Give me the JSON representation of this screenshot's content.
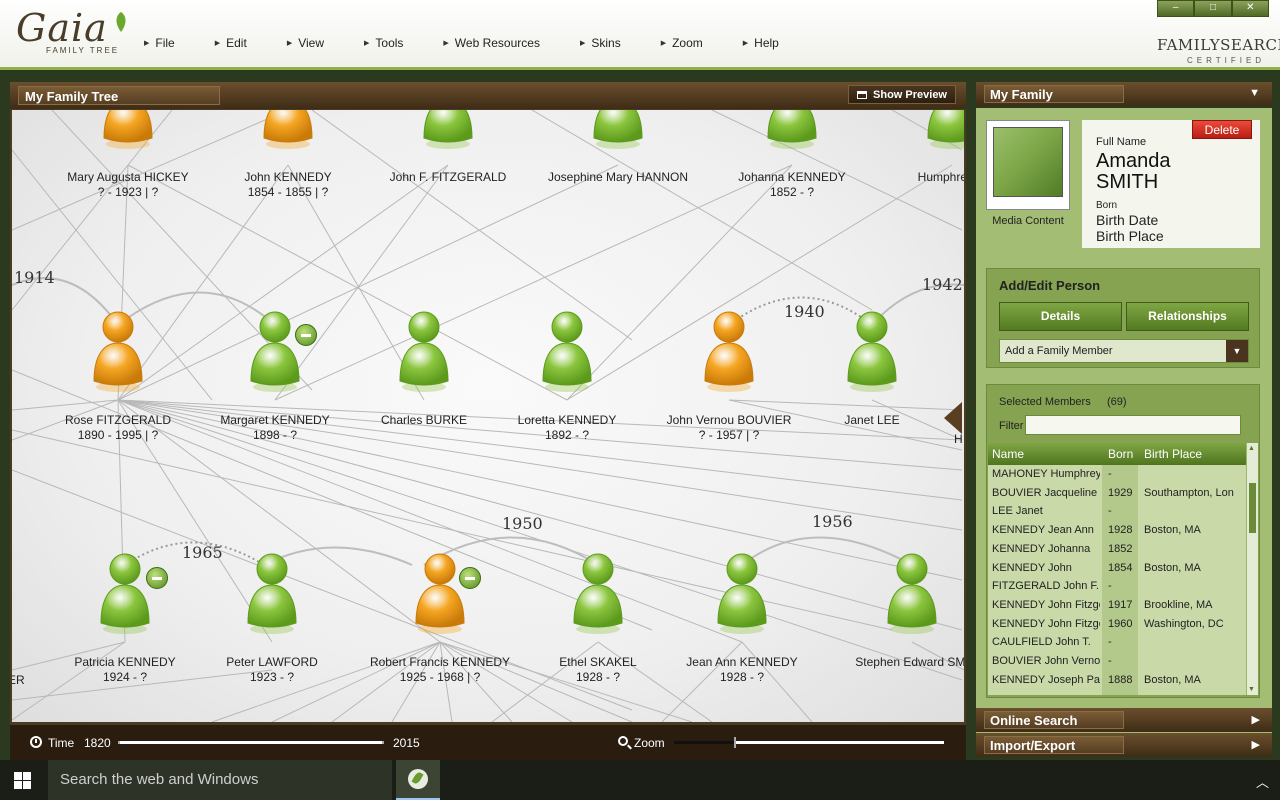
{
  "app": {
    "logo_text": "Gaia",
    "logo_sub": "FAMILY TREE",
    "certified_top": "FAMILYSEARCH",
    "certified_bottom": "CERTIFIED",
    "window_controls": [
      "–",
      "□",
      "✕"
    ]
  },
  "menu": [
    "File",
    "Edit",
    "View",
    "Tools",
    "Web Resources",
    "Skins",
    "Zoom",
    "Help"
  ],
  "tree_panel": {
    "title": "My Family Tree",
    "show_preview": "Show Preview",
    "years": [
      "1914",
      "1940",
      "1942",
      "1965",
      "1950",
      "1956"
    ],
    "people": [
      {
        "name": "Mary Augusta HICKEY",
        "dates": "? - 1923 | ?",
        "gender": "female"
      },
      {
        "name": "John KENNEDY",
        "dates": "1854 - 1855 | ?",
        "gender": "female"
      },
      {
        "name": "John F. FITZGERALD",
        "dates": "",
        "gender": "male"
      },
      {
        "name": "Josephine Mary HANNON",
        "dates": "",
        "gender": "male"
      },
      {
        "name": "Johanna KENNEDY",
        "dates": "1852 - ?",
        "gender": "male"
      },
      {
        "name": "Humphrey M",
        "dates": "",
        "gender": "male"
      },
      {
        "name": "Rose FITZGERALD",
        "dates": "1890 - 1995 | ?",
        "gender": "female"
      },
      {
        "name": "Margaret KENNEDY",
        "dates": "1898 - ?",
        "gender": "male"
      },
      {
        "name": "Charles BURKE",
        "dates": "",
        "gender": "male"
      },
      {
        "name": "Loretta KENNEDY",
        "dates": "1892 - ?",
        "gender": "male"
      },
      {
        "name": "John Vernou BOUVIER",
        "dates": "? - 1957 | ?",
        "gender": "female"
      },
      {
        "name": "Janet LEE",
        "dates": "",
        "gender": "male"
      },
      {
        "name": "Patricia KENNEDY",
        "dates": "1924 - ?",
        "gender": "male"
      },
      {
        "name": "Peter LAWFORD",
        "dates": "1923 - ?",
        "gender": "male"
      },
      {
        "name": "Robert Francis KENNEDY",
        "dates": "1925 - 1968 | ?",
        "gender": "female"
      },
      {
        "name": "Ethel SKAKEL",
        "dates": "1928 - ?",
        "gender": "male"
      },
      {
        "name": "Jean Ann KENNEDY",
        "dates": "1928 - ?",
        "gender": "male"
      },
      {
        "name": "Stephen Edward SMI",
        "dates": "",
        "gender": "male"
      }
    ],
    "partial_left": [
      "ER"
    ],
    "partial_right": "H",
    "time_label": "Time",
    "time_start": "1820",
    "time_end": "2015",
    "zoom_label": "Zoom",
    "zoom_level": 0.22
  },
  "family_panel": {
    "title": "My Family",
    "media_label": "Media Content",
    "delete": "Delete",
    "full_name_label": "Full Name",
    "first_name": "Amanda",
    "last_name": "SMITH",
    "born_label": "Born",
    "birth_date": "Birth Date",
    "birth_place": "Birth Place",
    "add_edit_title": "Add/Edit Person",
    "details": "Details",
    "relationships": "Relationships",
    "add_member": "Add a Family Member",
    "selected_title": "Selected Members",
    "selected_count": "(69)",
    "filter_label": "Filter",
    "filter_value": "",
    "columns": [
      "Name",
      "Born",
      "Birth Place"
    ],
    "rows": [
      [
        "MAHONEY Humphrey",
        "-",
        ""
      ],
      [
        "BOUVIER Jacqueline",
        "1929",
        "Southampton, Lon"
      ],
      [
        "LEE Janet",
        "-",
        ""
      ],
      [
        "KENNEDY Jean Ann",
        "1928",
        "Boston, MA"
      ],
      [
        "KENNEDY Johanna",
        "1852",
        ""
      ],
      [
        "KENNEDY John",
        "1854",
        "Boston, MA"
      ],
      [
        "FITZGERALD John F.",
        "-",
        ""
      ],
      [
        "KENNEDY John Fitzge",
        "1917",
        "Brookline, MA"
      ],
      [
        "KENNEDY John Fitzge",
        "1960",
        "Washington, DC"
      ],
      [
        "CAULFIELD John T.",
        "-",
        ""
      ],
      [
        "BOUVIER John Vernou",
        "-",
        ""
      ],
      [
        "KENNEDY Joseph Pat",
        "1888",
        "Boston, MA"
      ]
    ],
    "online_search": "Online Search",
    "import_export": "Import/Export"
  },
  "taskbar": {
    "search_placeholder": "Search the web and Windows"
  },
  "colors": {
    "male": "#8cc63f",
    "female": "#f5a623",
    "accent": "#6b8a3a",
    "header_brown": "#4a3420"
  }
}
